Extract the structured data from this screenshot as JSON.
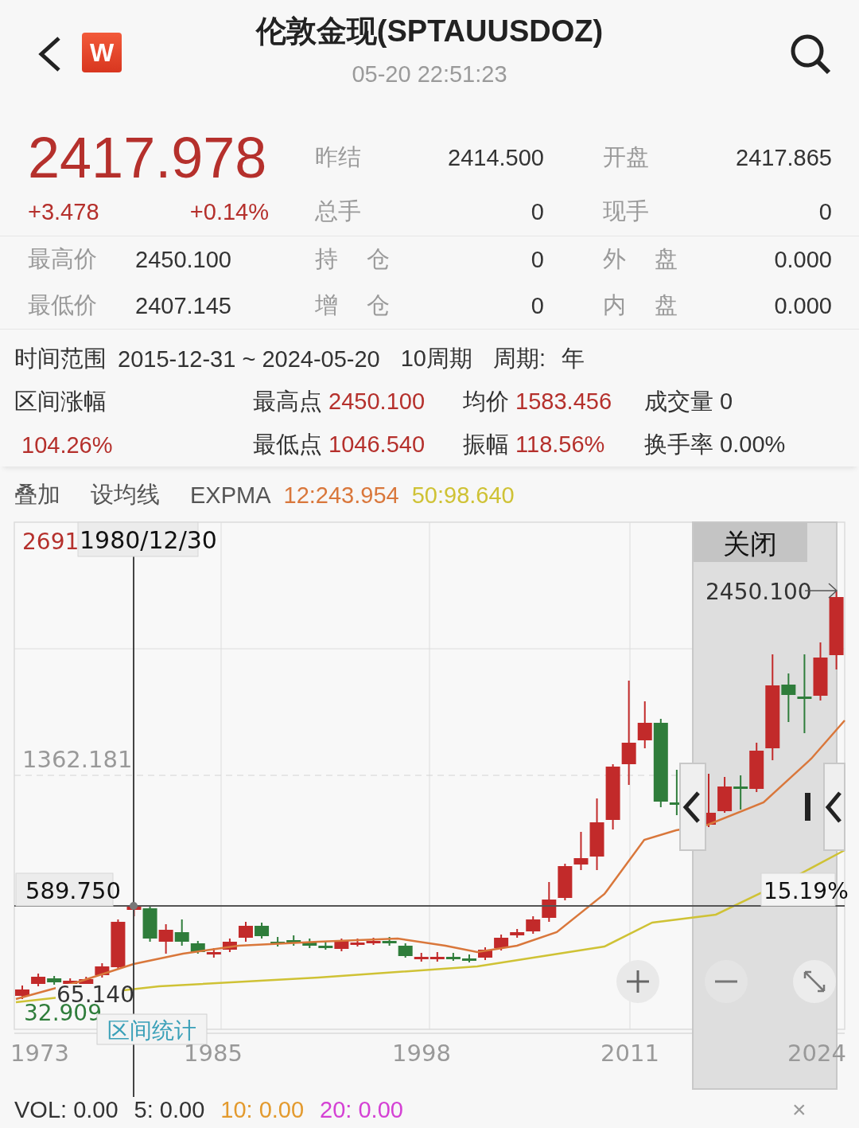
{
  "header": {
    "logo": "W",
    "title": "伦敦金现(SPTAUUSDOZ)",
    "time": "05-20 22:51:23"
  },
  "quote": {
    "price": "2417.978",
    "change": "+3.478",
    "change_pct": "+0.14%",
    "top_rows": [
      [
        {
          "label": "昨结",
          "value": "2414.500"
        },
        {
          "label": "开盘",
          "value": "2417.865"
        }
      ],
      [
        {
          "label": "总手",
          "value": "0"
        },
        {
          "label": "现手",
          "value": "0"
        }
      ]
    ],
    "bottom_rows": [
      [
        {
          "label": "最高价",
          "value": "2450.100"
        },
        {
          "label": "持 仓",
          "value": "0"
        },
        {
          "label": "外 盘",
          "value": "0.000"
        }
      ],
      [
        {
          "label": "最低价",
          "value": "2407.145"
        },
        {
          "label": "增 仓",
          "value": "0"
        },
        {
          "label": "内 盘",
          "value": "0.000"
        }
      ]
    ]
  },
  "range": {
    "label": "时间范围",
    "value": "2015-12-31 ~ 2024-05-20",
    "periods": "10周期",
    "cycle_label": "周期:",
    "cycle": "年",
    "change_label": "区间涨幅",
    "change": "104.26%",
    "metrics": [
      {
        "label": "最高点",
        "value": "2450.100",
        "color": "#b5302c"
      },
      {
        "label": "均价",
        "value": "1583.456",
        "color": "#b5302c"
      },
      {
        "label": "成交量",
        "value": "0",
        "color": "#333333"
      },
      {
        "label": "最低点",
        "value": "1046.540",
        "color": "#b5302c"
      },
      {
        "label": "振幅",
        "value": "118.56%",
        "color": "#b5302c"
      },
      {
        "label": "换手率",
        "value": "0.00%",
        "color": "#333333"
      }
    ]
  },
  "toolbar": {
    "overlay": "叠加",
    "ma": "设均线",
    "indicator": "EXPMA",
    "lines": [
      {
        "label": "12:243.954",
        "color": "#d9773b"
      },
      {
        "label": "50:98.640",
        "color": "#cfc235"
      }
    ]
  },
  "chart": {
    "top_label": "2691",
    "cursor_date": "1980/12/30",
    "mid_label": "1362.181",
    "cursor_price": "589.750",
    "cursor_pct": "15.19%",
    "max_label": "2450.100",
    "close_button": "关闭",
    "low_label": "65.140",
    "min_label": "32.909",
    "range_button": "区间统计",
    "xlabels": [
      "1973",
      "1985",
      "1998",
      "2011",
      "2024"
    ]
  },
  "volume": {
    "items": [
      {
        "label": "VOL: 0.00",
        "color": "#333333"
      },
      {
        "label": "5: 0.00",
        "color": "#333333"
      },
      {
        "label": "10: 0.00",
        "color": "#e39a2e"
      },
      {
        "label": "20: 0.00",
        "color": "#d441d4"
      }
    ],
    "close": "×"
  }
}
